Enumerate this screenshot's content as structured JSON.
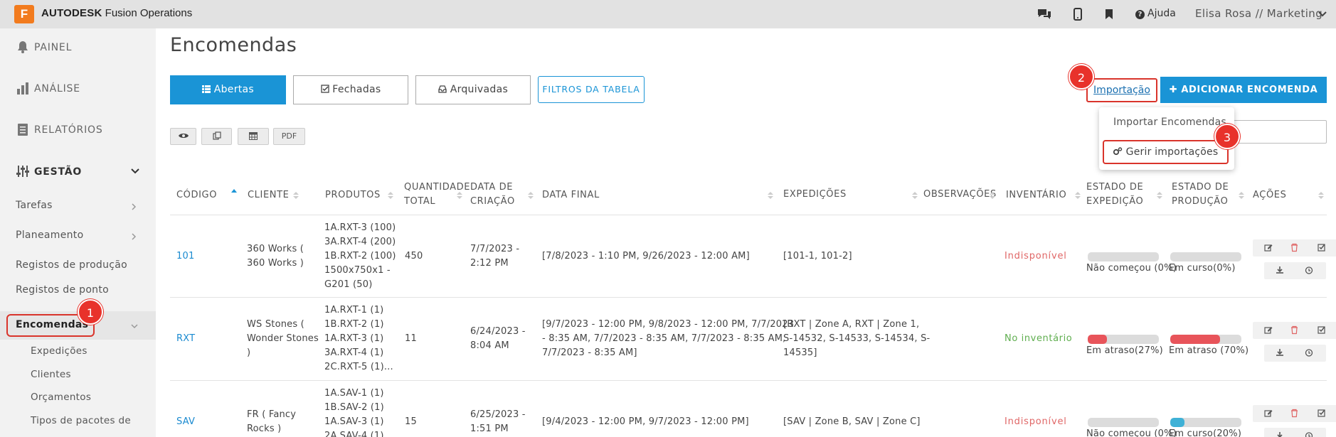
{
  "app": {
    "logo_letter": "F",
    "brand_bold": "AUTODESK",
    "brand_rest": " Fusion Operations",
    "help_label": "Ajuda",
    "user_label": "Elisa Rosa // Marketing",
    "accent_color": "#1a94d6",
    "highlight_color": "#e8322b"
  },
  "sidebar": {
    "main_items": [
      {
        "label": "PAINEL",
        "icon": "bell-icon"
      },
      {
        "label": "ANÁLISE",
        "icon": "bar-chart-icon"
      },
      {
        "label": "RELATÓRIOS",
        "icon": "report-icon"
      },
      {
        "label": "GESTÃO",
        "icon": "sliders-icon"
      }
    ],
    "sub_items": [
      "Tarefas",
      "Planeamento",
      "Registos de produção",
      "Registos de ponto",
      "Encomendas"
    ],
    "child_items": [
      "Expedições",
      "Clientes",
      "Orçamentos",
      "Tipos de pacotes de"
    ]
  },
  "annotations": {
    "badge1": "1",
    "badge2": "2",
    "badge3": "3"
  },
  "page": {
    "title": "Encomendas"
  },
  "tabs": [
    {
      "label": "Abertas",
      "icon": "list-icon"
    },
    {
      "label": "Fechadas",
      "icon": "check-square-icon"
    },
    {
      "label": "Arquivadas",
      "icon": "inbox-icon"
    }
  ],
  "filter_button": "FILTROS DA TABELA",
  "import_link": "Importação",
  "add_button": "ADICIONAR ENCOMENDA",
  "import_menu": {
    "item1": "Importar Encomendas",
    "item2": "Gerir importações"
  },
  "toolbar": {
    "pdf": "PDF"
  },
  "table": {
    "headers": {
      "codigo": "CÓDIGO",
      "cliente": "CLIENTE",
      "produtos": "PRODUTOS",
      "quantidade_1": "QUANTIDADE",
      "quantidade_2": "TOTAL",
      "data_criacao_1": "DATA DE",
      "data_criacao_2": "CRIAÇÃO",
      "data_final": "DATA FINAL",
      "expedicoes": "EXPEDIÇÕES",
      "observacoes": "OBSERVAÇÕES",
      "inventario": "INVENTÁRIO",
      "estado_exp_1": "ESTADO DE",
      "estado_exp_2": "EXPEDIÇÃO",
      "estado_prod_1": "ESTADO DE",
      "estado_prod_2": "PRODUÇÃO",
      "acoes": "AÇÕES"
    },
    "rows": [
      {
        "code": "101",
        "client": [
          "360 Works (",
          "360 Works )"
        ],
        "products": [
          "1A.RXT-3 (100)",
          "3A.RXT-4 (200)",
          "1B.RXT-2 (100)",
          "1500x750x1 -",
          "G201 (50)"
        ],
        "quantity": "450",
        "created": [
          "7/7/2023 -",
          "2:12 PM"
        ],
        "final": [
          "[7/8/2023 - 1:10 PM, 9/26/2023 - 12:00 AM]"
        ],
        "shipments": [
          "[101-1, 101-2]"
        ],
        "inventory": "Indisponível",
        "ship_status": {
          "label": "Não começou (0%)",
          "progress": 0,
          "color": "#dcdcdc"
        },
        "prod_status": {
          "label": "Em curso(0%)",
          "progress": 0,
          "color": "#dcdcdc"
        }
      },
      {
        "code": "RXT",
        "client": [
          "WS Stones (",
          "Wonder Stones",
          ")"
        ],
        "products": [
          "1A.RXT-1 (1)",
          "1B.RXT-2 (1)",
          "1A.RXT-3 (1)",
          "3A.RXT-4 (1)",
          "2C.RXT-5 (1)..."
        ],
        "quantity": "11",
        "created": [
          "6/24/2023 -",
          "8:04 AM"
        ],
        "final": [
          "[9/7/2023 - 12:00 PM, 9/8/2023 - 12:00 PM, 7/7/2023",
          "- 8:35 AM, 7/7/2023 - 8:35 AM, 7/7/2023 - 8:35 AM,",
          "7/7/2023 - 8:35 AM]"
        ],
        "shipments": [
          "[RXT | Zone A, RXT | Zone 1,",
          "S-14532, S-14533, S-14534, S-",
          "14535]"
        ],
        "inventory": "No inventário",
        "ship_status": {
          "label": "Em atraso(27%)",
          "progress": 0.27,
          "color": "#e8545a"
        },
        "prod_status": {
          "label": "Em atraso (70%)",
          "progress": 0.7,
          "color": "#e8545a"
        }
      },
      {
        "code": "SAV",
        "client": [
          "FR ( Fancy",
          "Rocks )"
        ],
        "products": [
          "1A.SAV-1 (1)",
          "1B.SAV-2 (1)",
          "1A.SAV-3 (1)",
          "2A.SAV-4 (1)"
        ],
        "quantity": "15",
        "created": [
          "6/25/2023 -",
          "1:51 PM"
        ],
        "final": [
          "[9/4/2023 - 12:00 PM, 9/7/2023 - 12:00 PM]"
        ],
        "shipments": [
          "[SAV | Zone B, SAV | Zone C]"
        ],
        "inventory": "Indisponível",
        "ship_status": {
          "label": "Não começou (0%)",
          "progress": 0,
          "color": "#dcdcdc"
        },
        "prod_status": {
          "label": "Em curso(20%)",
          "progress": 0.2,
          "color": "#3fb1d6"
        }
      }
    ]
  }
}
